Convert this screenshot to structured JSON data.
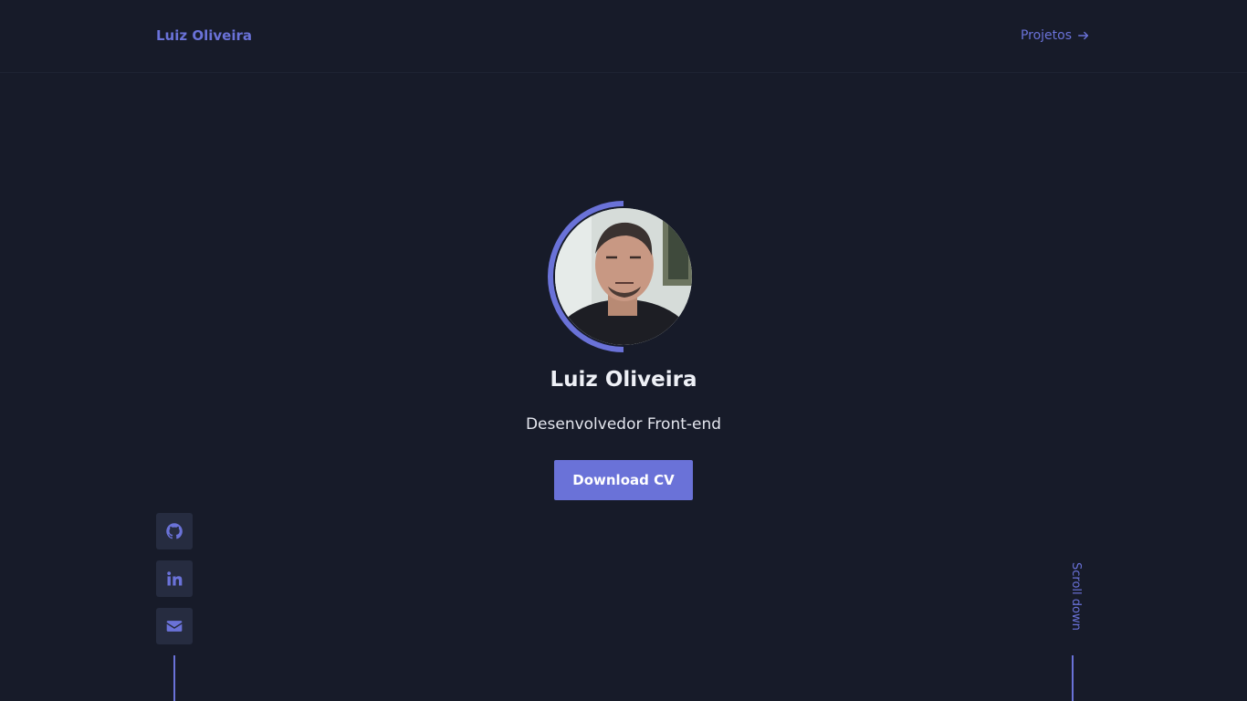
{
  "header": {
    "logo": "Luiz Oliveira",
    "nav_link": "Projetos",
    "nav_icon": "arrow-right-icon"
  },
  "hero": {
    "name": "Luiz Oliveira",
    "role": "Desenvolvedor Front-end",
    "cv_button": "Download CV"
  },
  "social": [
    {
      "icon": "github-icon"
    },
    {
      "icon": "linkedin-icon"
    },
    {
      "icon": "mail-icon"
    }
  ],
  "scroll": {
    "label": "Scroll down"
  },
  "colors": {
    "background": "#171b29",
    "accent": "#6a72d8",
    "social_bg": "#262c40",
    "text": "#eef0f6"
  }
}
